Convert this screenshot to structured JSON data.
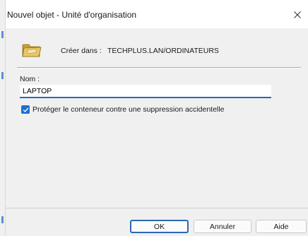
{
  "window": {
    "title": "Nouvel objet - Unité d'organisation"
  },
  "create_in": {
    "label": "Créer dans :",
    "path": "TECHPLUS.LAN/ORDINATEURS"
  },
  "name_field": {
    "label": "Nom :",
    "value": "LAPTOP"
  },
  "protect_checkbox": {
    "label": "Protéger le conteneur contre une suppression accidentelle",
    "checked": true
  },
  "buttons": {
    "ok": "OK",
    "cancel": "Annuler",
    "help": "Aide"
  },
  "colors": {
    "accent": "#2b68b5",
    "checkbox": "#1f6fd1",
    "folder": "#e8c766"
  },
  "icons": {
    "container": "folder-icon",
    "close": "close-icon",
    "check": "check-icon"
  }
}
